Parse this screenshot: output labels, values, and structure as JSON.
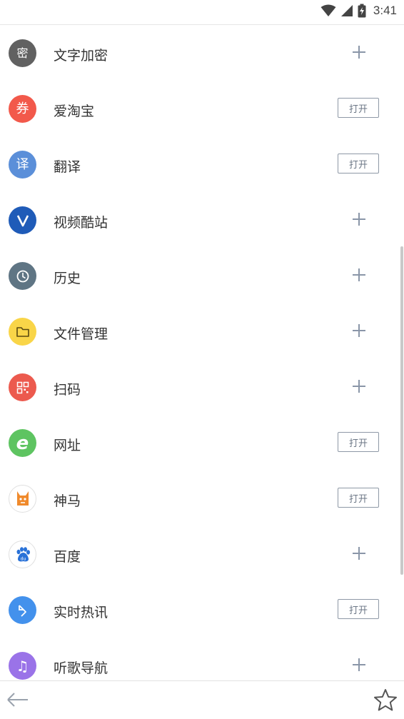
{
  "status_bar": {
    "time": "3:41",
    "icons": [
      "wifi-icon",
      "cellular-signal-icon",
      "battery-charging-icon"
    ]
  },
  "items": [
    {
      "label": "文字加密",
      "icon": "lock-text-icon",
      "icon_glyph": "密",
      "icon_color": "#616161",
      "action": "plus"
    },
    {
      "label": "爱淘宝",
      "icon": "coupon-icon",
      "icon_glyph": "券",
      "icon_color": "#f2594b",
      "action": "open",
      "action_label": "打开"
    },
    {
      "label": "翻译",
      "icon": "translate-icon",
      "icon_glyph": "译",
      "icon_color": "#5b8fd9",
      "action": "open",
      "action_label": "打开"
    },
    {
      "label": "视频酷站",
      "icon": "video-icon",
      "icon_glyph": "V",
      "icon_color": "#1f5bb8",
      "action": "plus"
    },
    {
      "label": "历史",
      "icon": "clock-icon",
      "icon_glyph": "",
      "icon_color": "#5f7584",
      "action": "plus"
    },
    {
      "label": "文件管理",
      "icon": "folder-icon",
      "icon_glyph": "",
      "icon_color": "#f9d548",
      "action": "plus"
    },
    {
      "label": "扫码",
      "icon": "qr-code-icon",
      "icon_glyph": "",
      "icon_color": "#ec5a4e",
      "action": "plus"
    },
    {
      "label": "网址",
      "icon": "web-address-icon",
      "icon_glyph": "e",
      "icon_color": "#5ec461",
      "action": "open",
      "action_label": "打开"
    },
    {
      "label": "神马",
      "icon": "shenma-icon",
      "icon_glyph": "",
      "icon_color": "#ffffff",
      "action": "open",
      "action_label": "打开"
    },
    {
      "label": "百度",
      "icon": "baidu-paw-icon",
      "icon_glyph": "",
      "icon_color": "#ffffff",
      "action": "plus"
    },
    {
      "label": "实时热讯",
      "icon": "hot-news-icon",
      "icon_glyph": "",
      "icon_color": "#4391ec",
      "action": "open",
      "action_label": "打开"
    },
    {
      "label": "听歌导航",
      "icon": "music-note-icon",
      "icon_glyph": "♫",
      "icon_color": "#9a73e8",
      "action": "plus"
    }
  ],
  "bottom_bar": {
    "back_icon": "arrow-left-icon",
    "favorite_icon": "star-outline-icon"
  },
  "colors": {
    "accent_gray": "#8a96a8",
    "divider": "#e2e2e2"
  }
}
